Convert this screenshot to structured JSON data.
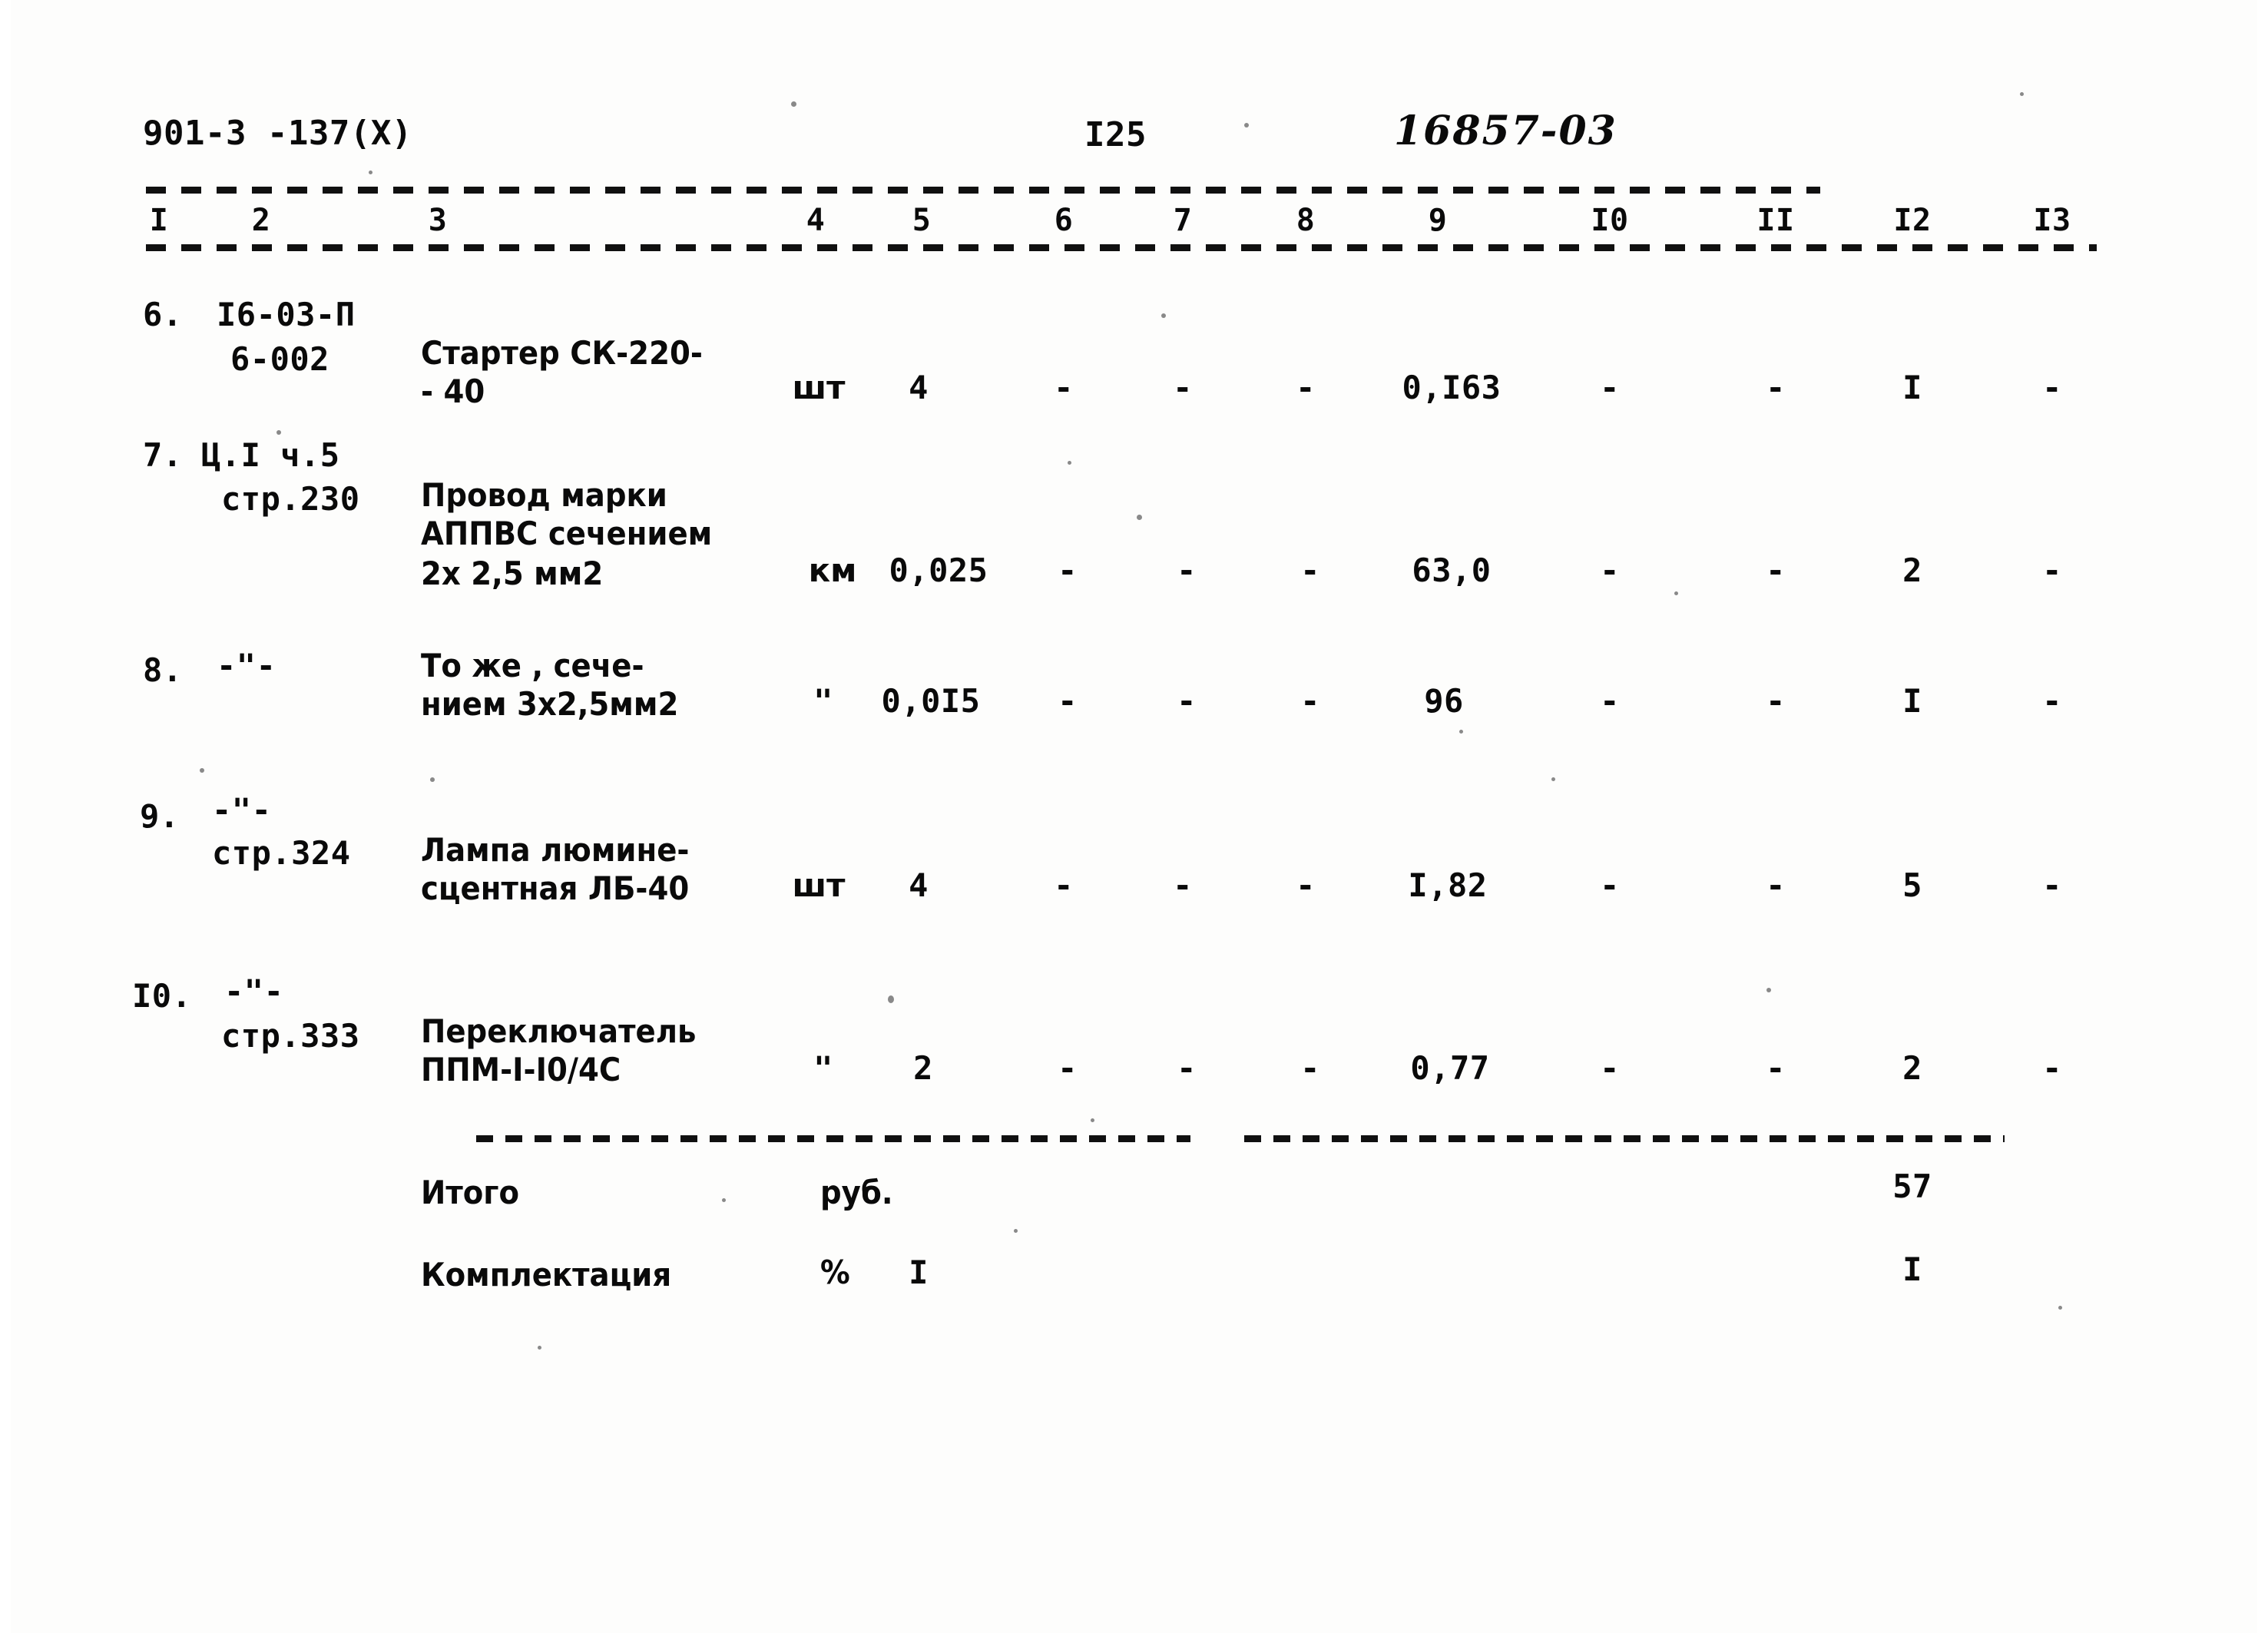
{
  "document": {
    "series_code": "901-3 -137(X)",
    "page_number": "I25",
    "archive_stamp": "16857-03"
  },
  "table": {
    "column_headers": [
      "I",
      "2",
      "3",
      "4",
      "5",
      "6",
      "7",
      "8",
      "9",
      "I0",
      "II",
      "I2",
      "I3"
    ],
    "rows": [
      {
        "index": "6.",
        "ref_line1": "I6-03-П",
        "ref_line2": "6-002",
        "name_line1": "Стартер СК-220-",
        "name_line2": "- 40",
        "name_line3": "",
        "unit": "шт",
        "qty": "4",
        "c6": "-",
        "c7": "-",
        "c8": "-",
        "c9": "0,I63",
        "c10": "-",
        "c11": "-",
        "c12": "I",
        "c13": "-"
      },
      {
        "index": "7.",
        "ref_line1": "Ц.I ч.5",
        "ref_line2": "стр.230",
        "name_line1": "Провод марки",
        "name_line2": "АППВС сечением",
        "name_line3": "2х 2,5 мм2",
        "unit": "км",
        "qty": "0,025",
        "c6": "-",
        "c7": "-",
        "c8": "-",
        "c9": "63,0",
        "c10": "-",
        "c11": "-",
        "c12": "2",
        "c13": "-"
      },
      {
        "index": "8.",
        "ref_line1": "-\"-",
        "ref_line2": "",
        "name_line1": "То же , сече-",
        "name_line2": "нием 3х2,5мм2",
        "name_line3": "",
        "unit": "\"",
        "qty": "0,0I5",
        "c6": "-",
        "c7": "-",
        "c8": "-",
        "c9": "96",
        "c10": "-",
        "c11": "-",
        "c12": "I",
        "c13": "-"
      },
      {
        "index": "9.",
        "ref_line1": "-\"-",
        "ref_line2": "стр.324",
        "name_line1": "Лампа люмине-",
        "name_line2": "сцентная ЛБ-40",
        "name_line3": "",
        "unit": "шт",
        "qty": "4",
        "c6": "-",
        "c7": "-",
        "c8": "-",
        "c9": "I,82",
        "c10": "-",
        "c11": "-",
        "c12": "5",
        "c13": "-"
      },
      {
        "index": "I0.",
        "ref_line1": "-\"-",
        "ref_line2": "стр.333",
        "name_line1": "Переключатель",
        "name_line2": "ППМ-I-I0/4С",
        "name_line3": "",
        "unit": "\"",
        "qty": "2",
        "c6": "-",
        "c7": "-",
        "c8": "-",
        "c9": "0,77",
        "c10": "-",
        "c11": "-",
        "c12": "2",
        "c13": "-"
      }
    ],
    "summary": [
      {
        "label": "Итого",
        "unit": "руб.",
        "qty": "",
        "c12": "57"
      },
      {
        "label": "Комплектация",
        "unit": "%",
        "qty": "I",
        "c12": "I"
      }
    ]
  }
}
